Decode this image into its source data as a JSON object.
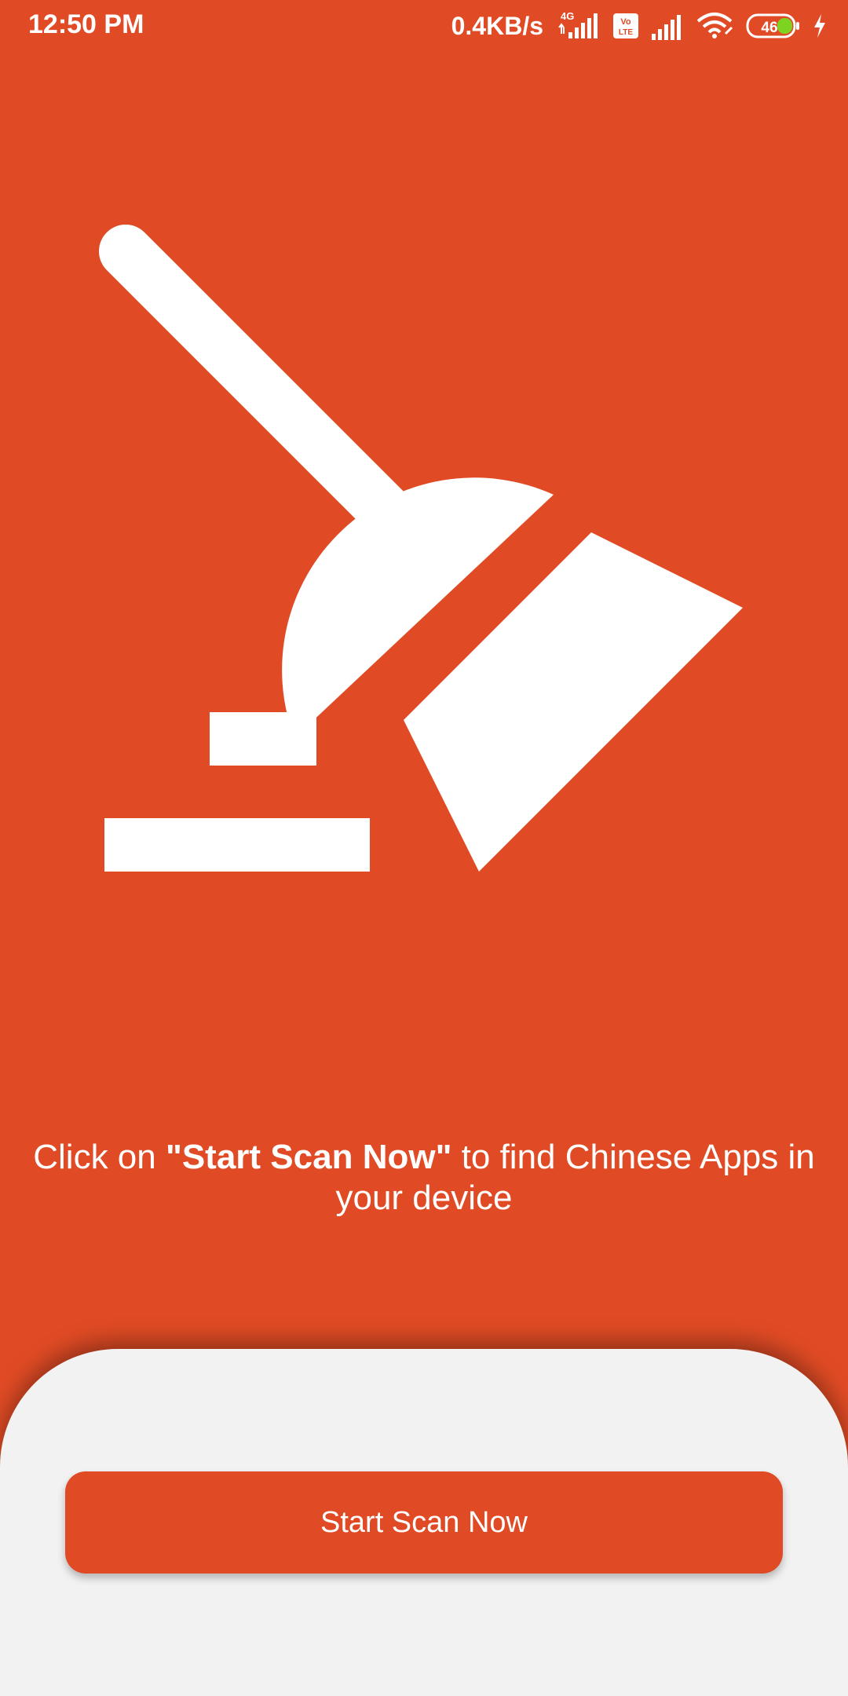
{
  "status_bar": {
    "time": "12:50 PM",
    "net_speed": "0.4KB/s",
    "network_type": "4G",
    "volte_label": "Vo LTE",
    "battery_level": "46"
  },
  "main": {
    "illustration_icon": "broom-cleaner-icon",
    "instruction_prefix": "Click on ",
    "instruction_highlight": "\"Start Scan Now\"",
    "instruction_suffix": " to find Chinese Apps in your device"
  },
  "bottom_panel": {
    "scan_button_label": "Start Scan Now"
  },
  "colors": {
    "accent": "#E04B25",
    "panel_bg": "#F2F2F2",
    "text_on_accent": "#FFFFFF",
    "battery_green": "#7ED321"
  }
}
